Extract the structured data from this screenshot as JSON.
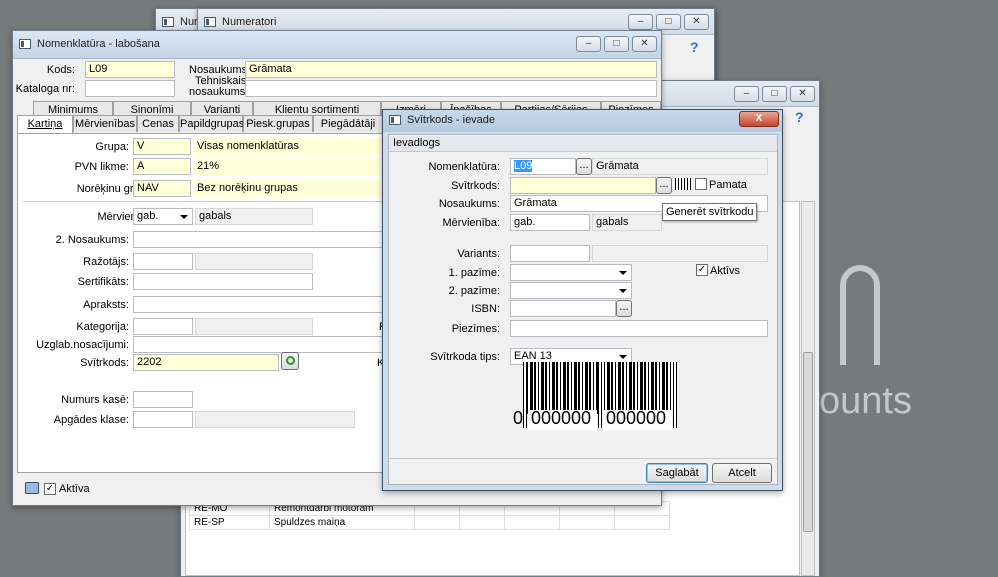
{
  "desktop": {
    "watermark": "counts"
  },
  "back_window_num1": {
    "title": "Nur"
  },
  "back_window_num2": {
    "title": "Numeratori",
    "help": "?"
  },
  "right_window": {
    "help": "?",
    "rows": [
      {
        "code": "RE-MO",
        "name": "Remontdarbi motoram"
      },
      {
        "code": "RE-SP",
        "name": "Spuldzes maiņa"
      }
    ]
  },
  "nomen": {
    "title": "Nomenklatūra - labošana",
    "kods_label": "Kods:",
    "kods_value": "L09",
    "nosaukums_label": "Nosaukums:",
    "nosaukums_value": "Grāmata",
    "kataloga_label": "Kataloga nr:",
    "teh_label1": "Tehniskais",
    "teh_label2": "nosaukums:",
    "tabs_row1": [
      "Minimums",
      "Sinonīmi",
      "Varianti",
      "Klientu sortimenti",
      "Izmēri",
      "Īpašības",
      "Partijas/Sērijas",
      "Piezīmes"
    ],
    "tabs_row2": [
      "Kartiņa",
      "Mērvienības",
      "Cenas",
      "Papildgrupas",
      "Piesk.grupas",
      "Piegādātāji"
    ],
    "grupa_label": "Grupa:",
    "grupa_code": "V",
    "grupa_name": "Visas nomenklatūras",
    "pvn_label": "PVN likme:",
    "pvn_code": "A",
    "pvn_pct": "21%",
    "noreik_label": "Norēķinu grupa:",
    "noreik_code": "NAV",
    "noreik_name": "Bez norēķinu grupas",
    "merv_label": "Mērvienība:",
    "merv_code": "gab.",
    "merv_name": "gabals",
    "nos2_label": "2. Nosaukums:",
    "razotajs_label": "Ražotājs:",
    "sert_label": "Sertifikāts:",
    "apraksts_label": "Apraksts:",
    "kategorija_label": "Kategorija:",
    "uzglab_label": "Uzglab.nosacījumi:",
    "svitr_label": "Svītrkods:",
    "svitr_value": "2202",
    "numurs_label": "Numurs kasē:",
    "apgades_label": "Apgādes klase:",
    "partial_F": "F",
    "partial_K": "K",
    "aktiva_label": "Aktīva"
  },
  "dialog": {
    "title": "Svītrkods - ievade",
    "close": "X",
    "section": "Ievadlogs",
    "nomen_label": "Nomenklatūra:",
    "nomen_code": "L09",
    "nomen_name": "Grāmata",
    "svitr_label": "Svītrkods:",
    "pamata_label": "Pamata",
    "tooltip": "Generēt svītrkodu",
    "nos_label": "Nosaukums:",
    "nos_value": "Grāmata",
    "merv_label": "Mērvienība:",
    "merv_code": "gab.",
    "merv_name": "gabals",
    "variants_label": "Variants:",
    "p1_label": "1. pazīme:",
    "aktivs_label": "Aktīvs",
    "p2_label": "2. pazīme:",
    "isbn_label": "ISBN:",
    "piez_label": "Piezīmes:",
    "tips_label": "Svītrkoda tips:",
    "tips_value": "EAN 13",
    "bc_first": "0",
    "bc_left": "000000",
    "bc_right": "000000",
    "save": "Saglabāt",
    "cancel": "Atcelt"
  }
}
